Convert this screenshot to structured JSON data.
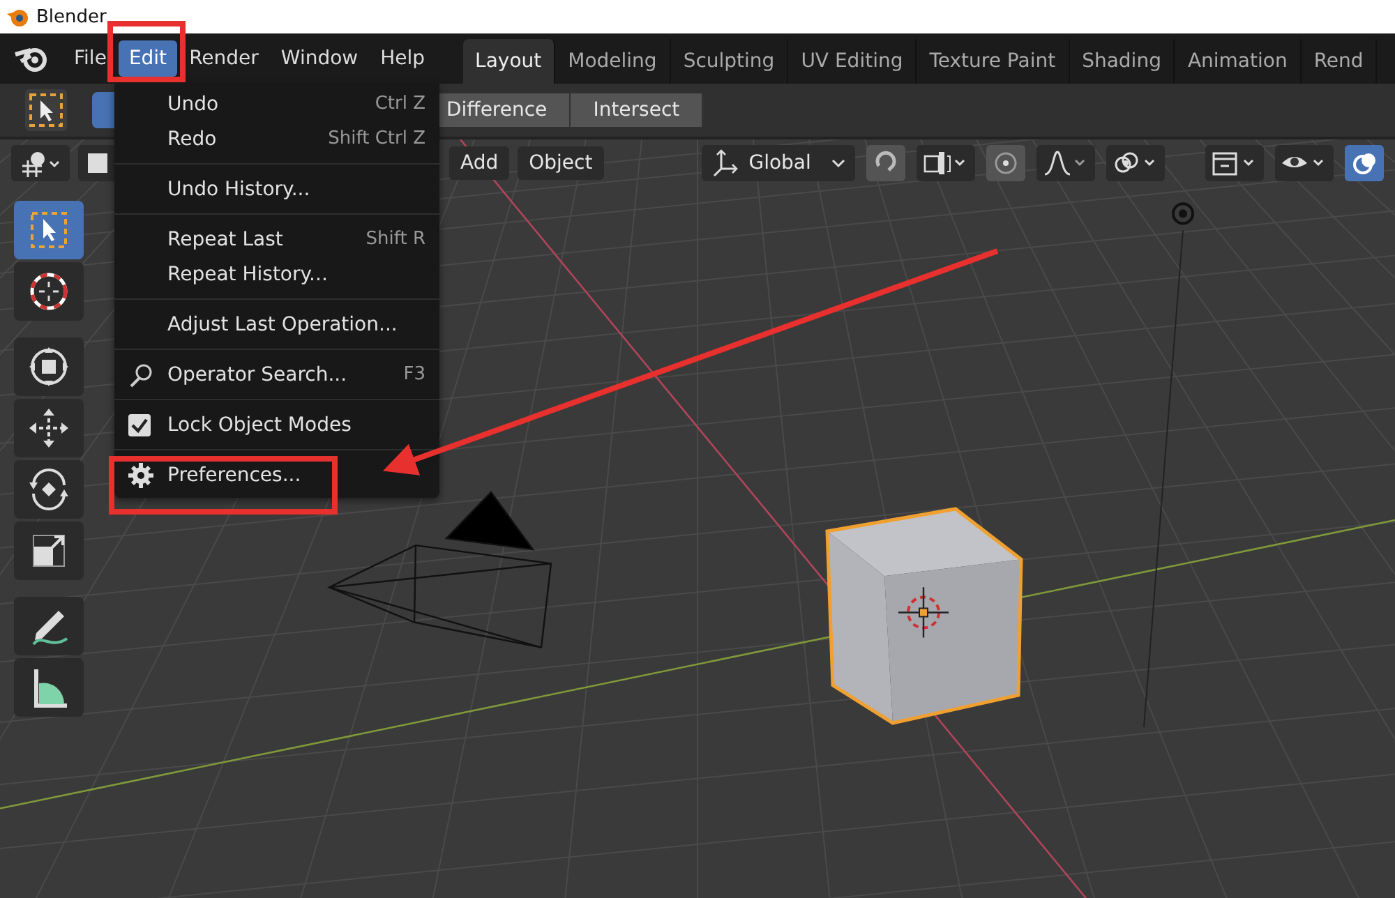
{
  "window": {
    "title": "Blender"
  },
  "menu_bar": [
    {
      "label": "File",
      "selected": false
    },
    {
      "label": "Edit",
      "selected": true
    },
    {
      "label": "Render",
      "selected": false
    },
    {
      "label": "Window",
      "selected": false
    },
    {
      "label": "Help",
      "selected": false
    }
  ],
  "workspace_tabs": [
    {
      "label": "Layout",
      "selected": true
    },
    {
      "label": "Modeling",
      "selected": false
    },
    {
      "label": "Sculpting",
      "selected": false
    },
    {
      "label": "UV Editing",
      "selected": false
    },
    {
      "label": "Texture Paint",
      "selected": false
    },
    {
      "label": "Shading",
      "selected": false
    },
    {
      "label": "Animation",
      "selected": false
    },
    {
      "label": "Rend",
      "selected": false
    }
  ],
  "tool_header": {
    "mode_buttons": [
      "Difference",
      "Intersect"
    ]
  },
  "viewport_header": {
    "menus": [
      "Add",
      "Object"
    ],
    "orientation": "Global"
  },
  "toolbar": [
    {
      "kind": "select_box",
      "selected": true,
      "new_group": false
    },
    {
      "kind": "cursor",
      "selected": false,
      "new_group": false
    },
    {
      "kind": "transform",
      "selected": false,
      "new_group": true
    },
    {
      "kind": "move",
      "selected": false,
      "new_group": false
    },
    {
      "kind": "rotate",
      "selected": false,
      "new_group": false
    },
    {
      "kind": "scale",
      "selected": false,
      "new_group": false
    },
    {
      "kind": "annotate",
      "selected": false,
      "new_group": true
    },
    {
      "kind": "measure",
      "selected": false,
      "new_group": false
    }
  ],
  "edit_menu": [
    {
      "kind": "command",
      "label": "Undo",
      "shortcut": "Ctrl Z"
    },
    {
      "kind": "command",
      "label": "Redo",
      "shortcut": "Shift Ctrl Z"
    },
    {
      "kind": "separator"
    },
    {
      "kind": "command",
      "label": "Undo History..."
    },
    {
      "kind": "separator"
    },
    {
      "kind": "command",
      "label": "Repeat Last",
      "shortcut": "Shift R"
    },
    {
      "kind": "command",
      "label": "Repeat History..."
    },
    {
      "kind": "separator"
    },
    {
      "kind": "command",
      "label": "Adjust Last Operation..."
    },
    {
      "kind": "separator"
    },
    {
      "kind": "search",
      "label": "Operator Search...",
      "shortcut": "F3"
    },
    {
      "kind": "separator"
    },
    {
      "kind": "checkbox",
      "label": "Lock Object Modes",
      "checked": true
    },
    {
      "kind": "separator"
    },
    {
      "kind": "settings",
      "label": "Preferences..."
    }
  ]
}
